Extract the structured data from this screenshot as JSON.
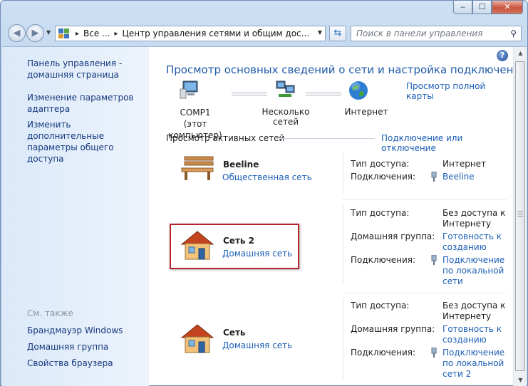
{
  "window": {
    "minimize": "‒",
    "maximize": "☐",
    "close": "✕"
  },
  "address": {
    "crumb1": "Все ...",
    "crumb2": "Центр управления сетями и общим дос..."
  },
  "search": {
    "placeholder": "Поиск в панели управления"
  },
  "sidebar": {
    "home_line1": "Панель управления -",
    "home_line2": "домашняя страница",
    "adapter_line1": "Изменение параметров",
    "adapter_line2": "адаптера",
    "sharing_line1": "Изменить дополнительные",
    "sharing_line2": "параметры общего доступа",
    "see_also": "См. также",
    "firewall": "Брандмауэр Windows",
    "homegroup": "Домашняя группа",
    "browser": "Свойства браузера"
  },
  "main": {
    "title": "Просмотр основных сведений о сети и настройка подключений",
    "full_map": "Просмотр полной карты",
    "node_computer_line1": "COMP1",
    "node_computer_line2": "(этот компьютер)",
    "node_networks": "Несколько сетей",
    "node_internet": "Интернет",
    "active_networks": "Просмотр активных сетей",
    "connect_disconnect": "Подключение или отключение"
  },
  "networks": [
    {
      "name": "Beeline",
      "type": "Общественная сеть",
      "access_label": "Тип доступа:",
      "access_value": "Интернет",
      "connections_label": "Подключения:",
      "connections_value": "Beeline"
    },
    {
      "name": "Сеть  2",
      "type": "Домашняя сеть",
      "access_label": "Тип доступа:",
      "access_value_line1": "Без доступа к",
      "access_value_line2": "Интернету",
      "homegroup_label": "Домашняя группа:",
      "homegroup_value_line1": "Готовность к",
      "homegroup_value_line2": "созданию",
      "connections_label": "Подключения:",
      "connections_value_line1": "Подключение",
      "connections_value_line2": "по локальной",
      "connections_value_line3": "сети"
    },
    {
      "name": "Сеть",
      "type": "Домашняя сеть",
      "access_label": "Тип доступа:",
      "access_value_line1": "Без доступа к",
      "access_value_line2": "Интернету",
      "homegroup_label": "Домашняя группа:",
      "homegroup_value_line1": "Готовность к",
      "homegroup_value_line2": "созданию",
      "connections_label": "Подключения:",
      "connections_value_line1": "Подключение",
      "connections_value_line2": "по локальной",
      "connections_value_line3": "сети 2"
    }
  ],
  "colors": {
    "link": "#1b5fb5",
    "title": "#1d5aa8",
    "highlight": "#b3252a"
  }
}
